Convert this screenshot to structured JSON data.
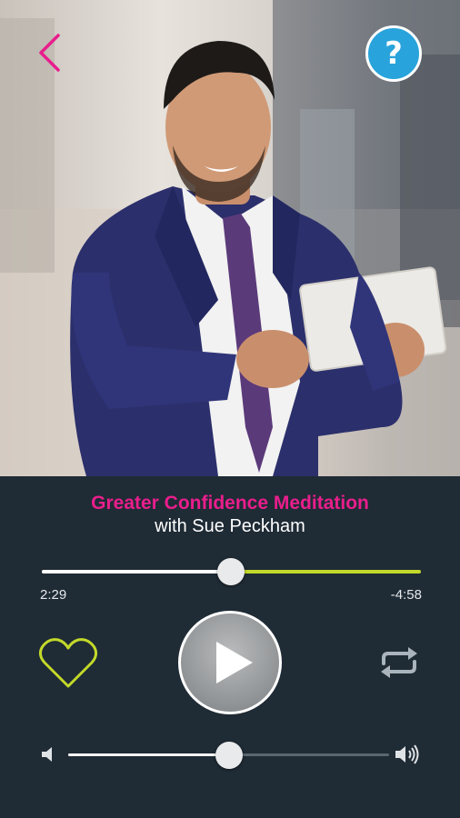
{
  "hero": {
    "back_icon": "chevron-left-icon",
    "help_label": "?",
    "help_icon": "help-icon"
  },
  "track": {
    "title": "Greater Confidence Meditation",
    "artist": "with Sue Peckham"
  },
  "progress": {
    "elapsed": "2:29",
    "remaining": "-4:58",
    "fraction": 0.5
  },
  "controls": {
    "favorite_icon": "heart-outline-icon",
    "play_icon": "play-icon",
    "repeat_icon": "repeat-icon"
  },
  "volume": {
    "level": 0.5,
    "down_icon": "volume-low-icon",
    "up_icon": "volume-high-icon"
  },
  "colors": {
    "accent_pink": "#e91e8c",
    "accent_lime": "#c3d92a",
    "help_blue": "#29a3db",
    "panel": "#1f2b35"
  }
}
